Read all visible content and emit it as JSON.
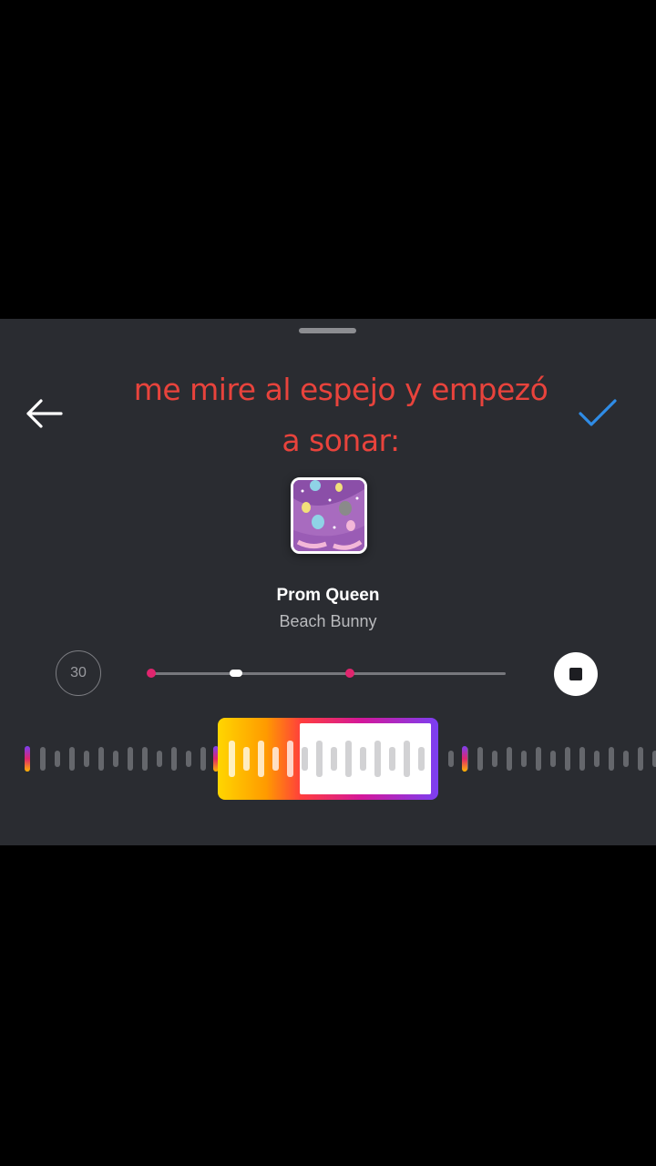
{
  "overlay_text": {
    "line1": "me mire al espejo y empezó",
    "line2": "a sonar:"
  },
  "song": {
    "title": "Prom Queen",
    "artist": "Beach Bunny"
  },
  "controls": {
    "duration_label": "30",
    "back_icon": "arrow-left-icon",
    "done_icon": "check-icon",
    "stop_icon": "stop-icon"
  },
  "seek": {
    "position_fraction": 0.24,
    "marker_fractions": [
      0.0,
      0.56
    ]
  },
  "selection": {
    "played_fraction": 0.37
  },
  "colors": {
    "overlay_text": "#e8433c",
    "accent_check": "#2f8ce6",
    "seek_marker": "#e0256e",
    "sheet_background": "#2a2c31"
  }
}
